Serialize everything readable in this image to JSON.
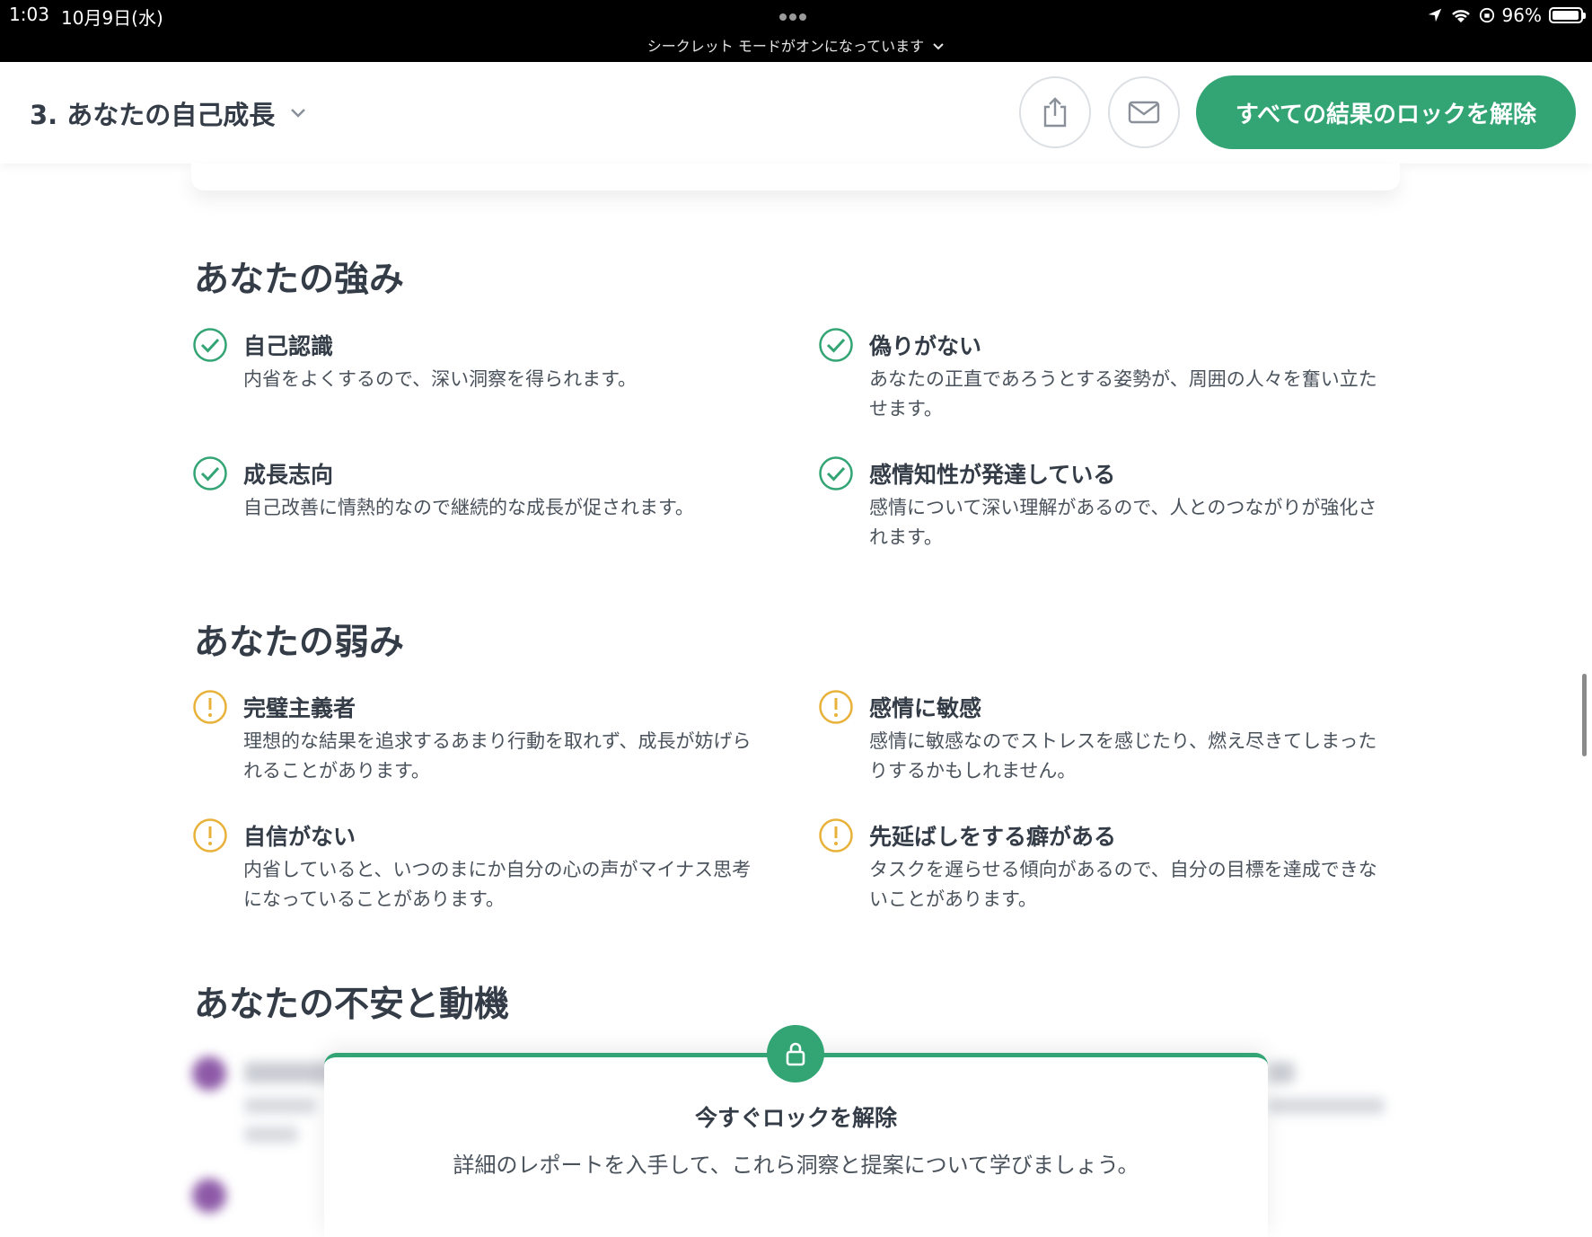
{
  "status_bar": {
    "time": "1:03",
    "date": "10月9日(水)",
    "battery": "96%",
    "battery_level": 0.96,
    "incognito_notice": "シークレット モードがオンになっています"
  },
  "header": {
    "section_title": "3. あなたの自己成長",
    "unlock_button": "すべての結果のロックを解除"
  },
  "strengths": {
    "title": "あなたの強み",
    "items": [
      {
        "name": "自己認識",
        "desc": "内省をよくするので、深い洞察を得られます。"
      },
      {
        "name": "偽りがない",
        "desc": "あなたの正直であろうとする姿勢が、周囲の人々を奮い立たせます。"
      },
      {
        "name": "成長志向",
        "desc": "自己改善に情熱的なので継続的な成長が促されます。"
      },
      {
        "name": "感情知性が発達している",
        "desc": "感情について深い理解があるので、人とのつながりが強化されます。"
      }
    ]
  },
  "weaknesses": {
    "title": "あなたの弱み",
    "items": [
      {
        "name": "完璧主義者",
        "desc": "理想的な結果を追求するあまり行動を取れず、成長が妨げられることがあります。"
      },
      {
        "name": "感情に敏感",
        "desc": "感情に敏感なのでストレスを感じたり、燃え尽きてしまったりするかもしれません。"
      },
      {
        "name": "自信がない",
        "desc": "内省していると、いつのまにか自分の心の声がマイナス思考になっていることがあります。"
      },
      {
        "name": "先延ばしをする癖がある",
        "desc": "タスクを遅らせる傾向があるので、自分の目標を達成できないことがあります。"
      }
    ]
  },
  "anxieties": {
    "title": "あなたの不安と動機"
  },
  "unlock_panel": {
    "title": "今すぐロックを解除",
    "text": "詳細のレポートを入手して、これら洞察と提案について学びましょう。"
  },
  "colors": {
    "accent": "#33a474",
    "warning": "#e8b23a",
    "text": "#343c47"
  }
}
